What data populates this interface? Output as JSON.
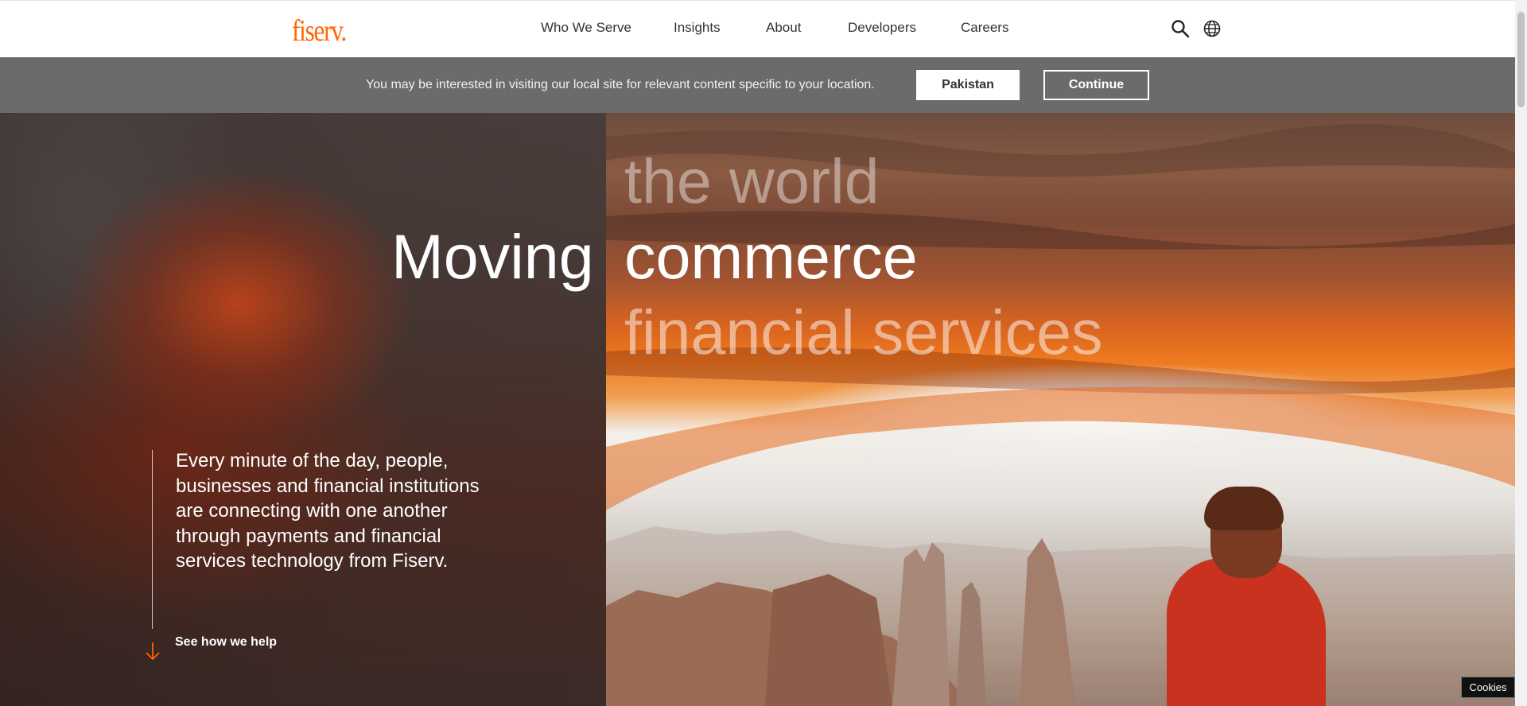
{
  "header": {
    "logo": "fiserv.",
    "nav": [
      "Who We Serve",
      "Insights",
      "About",
      "Developers",
      "Careers"
    ],
    "search_icon": "search-icon",
    "globe_icon": "globe-icon"
  },
  "location_bar": {
    "message": "You may be interested in visiting our local site for relevant content specific to your location.",
    "country_button": "Pakistan",
    "continue_button": "Continue"
  },
  "hero": {
    "lead": "Moving",
    "words": [
      "the world",
      "commerce",
      "financial services"
    ],
    "description": "Every minute of the day, people, businesses and financial institutions are connecting with one another through payments and financial services technology from Fiserv.",
    "cta": "See how we help",
    "cta_icon": "arrow-down-icon"
  },
  "cookies_button": "Cookies",
  "colors": {
    "brand": "#ff6600",
    "location_bar": "#6b6b6b"
  }
}
